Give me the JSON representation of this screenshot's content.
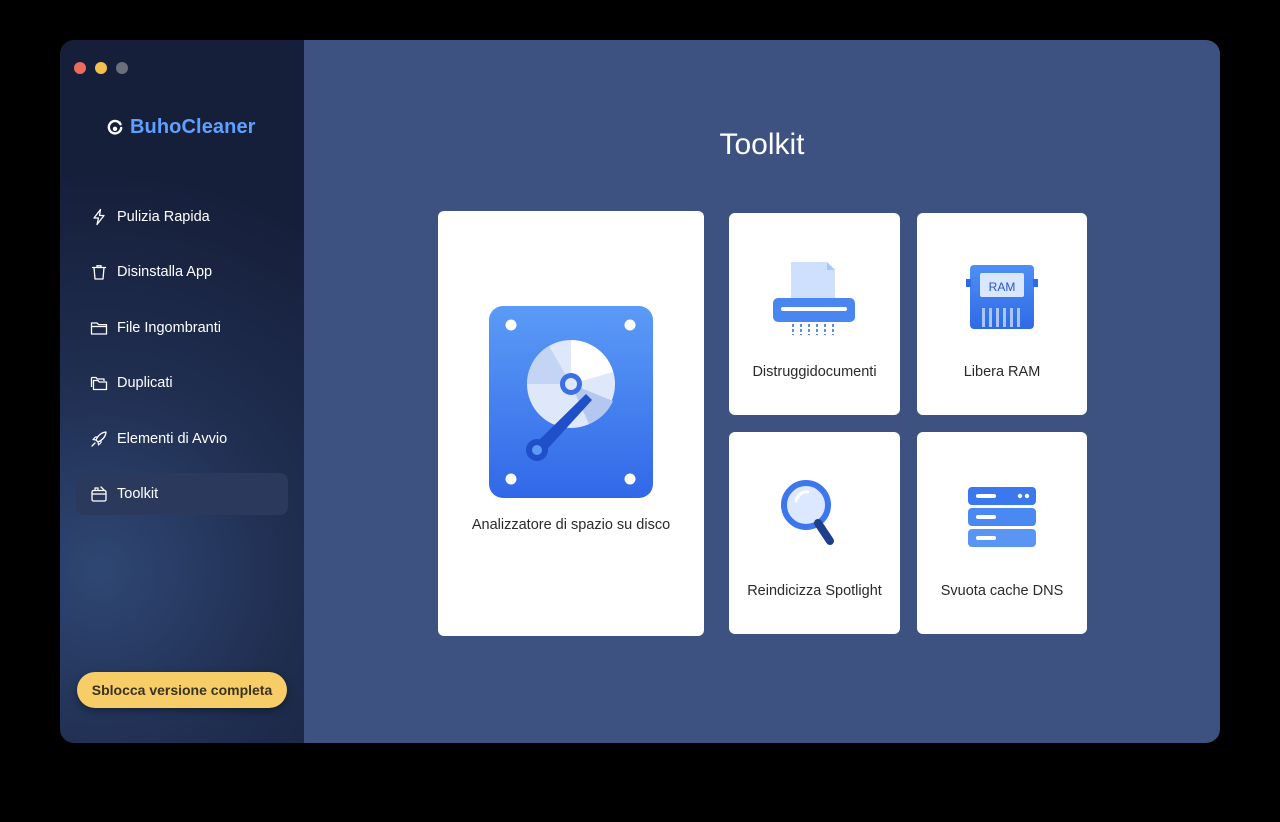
{
  "sidebar": {
    "brand": "BuhoCleaner",
    "items": [
      {
        "label": "Pulizia Rapida",
        "icon": "lightning-icon"
      },
      {
        "label": "Disinstalla App",
        "icon": "trash-icon"
      },
      {
        "label": "File Ingombranti",
        "icon": "folder-icon"
      },
      {
        "label": "Duplicati",
        "icon": "duplicate-folder-icon"
      },
      {
        "label": "Elementi di Avvio",
        "icon": "rocket-icon"
      },
      {
        "label": "Toolkit",
        "icon": "toolkit-icon",
        "active": true
      }
    ],
    "unlock_label": "Sblocca versione completa"
  },
  "main": {
    "title": "Toolkit",
    "tools": [
      {
        "label": "Analizzatore di spazio su disco",
        "icon": "disk-analyzer-icon"
      },
      {
        "label": "Distruggidocumenti",
        "icon": "shredder-icon"
      },
      {
        "label": "Libera RAM",
        "icon": "ram-chip-icon",
        "chip_text": "RAM"
      },
      {
        "label": "Reindicizza Spotlight",
        "icon": "magnifier-icon"
      },
      {
        "label": "Svuota cache DNS",
        "icon": "server-icon"
      }
    ]
  },
  "colors": {
    "accent": "#5fa0ff",
    "main_bg": "#3d5280",
    "sidebar_bg": "#161f3a",
    "unlock_button": "#f6cd66",
    "icon_blue": "#3d7cf0"
  }
}
